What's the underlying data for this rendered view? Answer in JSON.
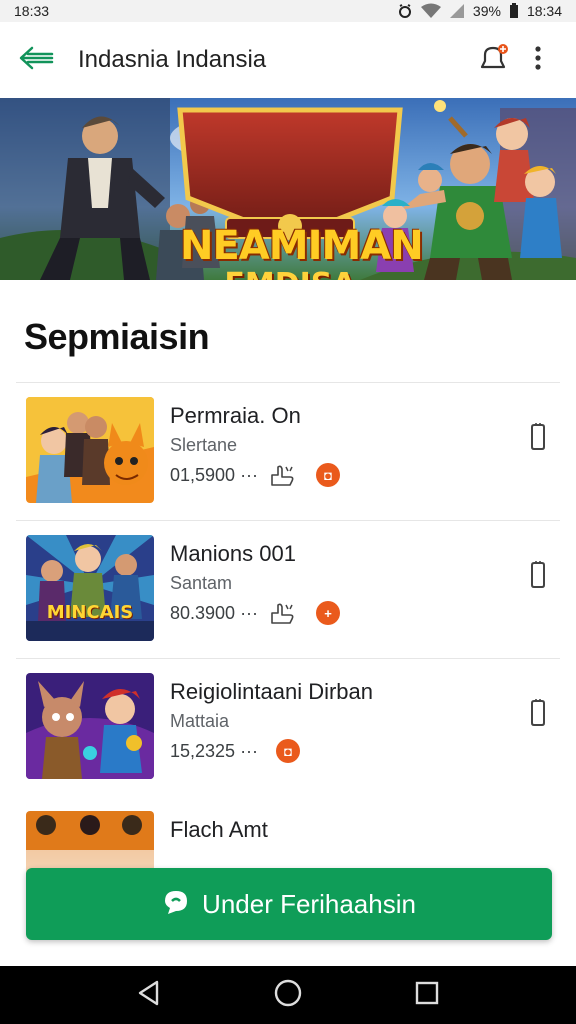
{
  "status_bar": {
    "time": "18:33",
    "battery": "39%",
    "clock_right": "18:34"
  },
  "app_bar": {
    "title": "Indasnia Indansia",
    "back_icon": "arrow-back-icon",
    "notify_icon": "notification-bell-icon",
    "menu_icon": "more-vert-icon"
  },
  "banner": {
    "title": "NEAMIMAN",
    "subtitle": "FMDISA"
  },
  "section": {
    "title": "Sepmiaisin"
  },
  "items": [
    {
      "title": "Permraia. On",
      "subtitle": "Slertane",
      "count": "01,5900 ···",
      "thumb_label": ""
    },
    {
      "title": "Manions 001",
      "subtitle": "Santam",
      "count": "80.3900 ···",
      "thumb_label": "MINCAIS"
    },
    {
      "title": "Reigiolintaani Dirban",
      "subtitle": "Mattaia",
      "count": "15,2325 ···",
      "thumb_label": ""
    },
    {
      "title": "Flach Amt",
      "subtitle": "",
      "count": "",
      "thumb_label": ""
    }
  ],
  "cta": {
    "label": "Under Ferihaahsin",
    "icon": "chat-bubble-icon"
  },
  "colors": {
    "primary_green": "#0f9d58",
    "badge_orange": "#ea5a1c"
  }
}
